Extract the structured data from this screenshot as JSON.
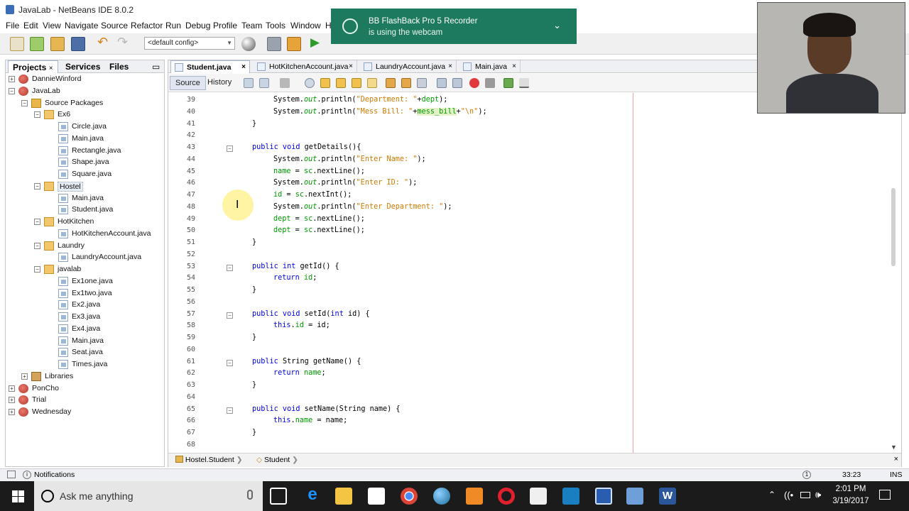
{
  "window": {
    "title": "JavaLab - NetBeans IDE 8.0.2"
  },
  "menu": [
    "File",
    "Edit",
    "View",
    "Navigate",
    "Source",
    "Refactor",
    "Run",
    "Debug",
    "Profile",
    "Team",
    "Tools",
    "Window",
    "H"
  ],
  "toolbar": {
    "config": "<default config>"
  },
  "left_panel": {
    "tabs": [
      "Projects",
      "Services",
      "Files"
    ],
    "close": "×",
    "minimize": "▭",
    "tree": [
      {
        "label": "DannieWinford",
        "type": "project",
        "depth": 0,
        "expander": "+"
      },
      {
        "label": "JavaLab",
        "type": "project",
        "depth": 0,
        "expander": "−"
      },
      {
        "label": "Source Packages",
        "type": "pkgfolder",
        "depth": 1,
        "expander": "−"
      },
      {
        "label": "Ex6",
        "type": "package",
        "depth": 2,
        "expander": "−"
      },
      {
        "label": "Circle.java",
        "type": "java",
        "depth": 3
      },
      {
        "label": "Main.java",
        "type": "java",
        "depth": 3
      },
      {
        "label": "Rectangle.java",
        "type": "java",
        "depth": 3
      },
      {
        "label": "Shape.java",
        "type": "java",
        "depth": 3
      },
      {
        "label": "Square.java",
        "type": "java",
        "depth": 3
      },
      {
        "label": "Hostel",
        "type": "package",
        "depth": 2,
        "expander": "−",
        "selected": true
      },
      {
        "label": "Main.java",
        "type": "java",
        "depth": 3
      },
      {
        "label": "Student.java",
        "type": "java",
        "depth": 3
      },
      {
        "label": "HotKitchen",
        "type": "package",
        "depth": 2,
        "expander": "−"
      },
      {
        "label": "HotKitchenAccount.java",
        "type": "java",
        "depth": 3
      },
      {
        "label": "Laundry",
        "type": "package",
        "depth": 2,
        "expander": "−"
      },
      {
        "label": "LaundryAccount.java",
        "type": "java",
        "depth": 3
      },
      {
        "label": "javalab",
        "type": "package",
        "depth": 2,
        "expander": "−"
      },
      {
        "label": "Ex1one.java",
        "type": "java",
        "depth": 3
      },
      {
        "label": "Ex1two.java",
        "type": "java",
        "depth": 3
      },
      {
        "label": "Ex2.java",
        "type": "java",
        "depth": 3
      },
      {
        "label": "Ex3.java",
        "type": "java",
        "depth": 3
      },
      {
        "label": "Ex4.java",
        "type": "java",
        "depth": 3
      },
      {
        "label": "Main.java",
        "type": "java",
        "depth": 3
      },
      {
        "label": "Seat.java",
        "type": "java",
        "depth": 3
      },
      {
        "label": "Times.java",
        "type": "java",
        "depth": 3
      },
      {
        "label": "Libraries",
        "type": "library",
        "depth": 1,
        "expander": "+"
      },
      {
        "label": "PonCho",
        "type": "project",
        "depth": 0,
        "expander": "+"
      },
      {
        "label": "Trial",
        "type": "project",
        "depth": 0,
        "expander": "+"
      },
      {
        "label": "Wednesday",
        "type": "project",
        "depth": 0,
        "expander": "+"
      }
    ]
  },
  "editor": {
    "tabs": [
      {
        "label": "Student.java",
        "active": true
      },
      {
        "label": "HotKitchenAccount.java"
      },
      {
        "label": "LaundryAccount.java"
      },
      {
        "label": "Main.java"
      }
    ],
    "tab_close": "×",
    "views": [
      "Source",
      "History"
    ],
    "lines": [
      {
        "n": "39",
        "indent": 2,
        "parts": [
          [
            "",
            "System."
          ],
          [
            "it",
            "out"
          ],
          [
            "",
            ".println("
          ],
          [
            "str",
            "\"Department: \""
          ],
          [
            "",
            "+"
          ],
          [
            "fld",
            "dept"
          ],
          [
            "",
            ");"
          ]
        ]
      },
      {
        "n": "40",
        "indent": 2,
        "parts": [
          [
            "",
            "System."
          ],
          [
            "it",
            "out"
          ],
          [
            "",
            ".println("
          ],
          [
            "str",
            "\"Mess Bill: \""
          ],
          [
            "",
            "+"
          ],
          [
            "fld hl",
            "mess_bill"
          ],
          [
            "",
            "+"
          ],
          [
            "str",
            "\"\\n\""
          ],
          [
            "",
            ");"
          ]
        ]
      },
      {
        "n": "41",
        "indent": 1,
        "parts": [
          [
            "",
            "}"
          ]
        ]
      },
      {
        "n": "42",
        "indent": 0,
        "parts": []
      },
      {
        "n": "43",
        "indent": 1,
        "fold": true,
        "parts": [
          [
            "kw",
            "public void "
          ],
          [
            "",
            "getDetails(){"
          ]
        ]
      },
      {
        "n": "44",
        "indent": 2,
        "parts": [
          [
            "",
            "System."
          ],
          [
            "it",
            "out"
          ],
          [
            "",
            ".println("
          ],
          [
            "str",
            "\"Enter Name: \""
          ],
          [
            "",
            ");"
          ]
        ]
      },
      {
        "n": "45",
        "indent": 2,
        "parts": [
          [
            "fld",
            "name"
          ],
          [
            "",
            " = "
          ],
          [
            "fld",
            "sc"
          ],
          [
            "",
            ".nextLine();"
          ]
        ]
      },
      {
        "n": "46",
        "indent": 2,
        "parts": [
          [
            "",
            "System."
          ],
          [
            "it",
            "out"
          ],
          [
            "",
            ".println("
          ],
          [
            "str",
            "\"Enter ID: \""
          ],
          [
            "",
            ");"
          ]
        ]
      },
      {
        "n": "47",
        "indent": 2,
        "parts": [
          [
            "fld",
            "id"
          ],
          [
            "",
            " = "
          ],
          [
            "fld",
            "sc"
          ],
          [
            "",
            ".nextInt();"
          ]
        ]
      },
      {
        "n": "48",
        "indent": 2,
        "parts": [
          [
            "",
            "System."
          ],
          [
            "it",
            "out"
          ],
          [
            "",
            ".println("
          ],
          [
            "str",
            "\"Enter Department: \""
          ],
          [
            "",
            ");"
          ]
        ]
      },
      {
        "n": "49",
        "indent": 2,
        "parts": [
          [
            "fld",
            "dept"
          ],
          [
            "",
            " = "
          ],
          [
            "fld",
            "sc"
          ],
          [
            "",
            ".nextLine();"
          ]
        ]
      },
      {
        "n": "50",
        "indent": 2,
        "parts": [
          [
            "fld",
            "dept"
          ],
          [
            "",
            " = "
          ],
          [
            "fld",
            "sc"
          ],
          [
            "",
            ".nextLine();"
          ]
        ]
      },
      {
        "n": "51",
        "indent": 1,
        "parts": [
          [
            "",
            "}"
          ]
        ]
      },
      {
        "n": "52",
        "indent": 0,
        "parts": []
      },
      {
        "n": "53",
        "indent": 1,
        "fold": true,
        "parts": [
          [
            "kw",
            "public int "
          ],
          [
            "",
            "getId() {"
          ]
        ]
      },
      {
        "n": "54",
        "indent": 2,
        "parts": [
          [
            "kw",
            "return "
          ],
          [
            "fld",
            "id"
          ],
          [
            "",
            ";"
          ]
        ]
      },
      {
        "n": "55",
        "indent": 1,
        "parts": [
          [
            "",
            "}"
          ]
        ]
      },
      {
        "n": "56",
        "indent": 0,
        "parts": []
      },
      {
        "n": "57",
        "indent": 1,
        "fold": true,
        "parts": [
          [
            "kw",
            "public void "
          ],
          [
            "",
            "setId("
          ],
          [
            "kw",
            "int "
          ],
          [
            "",
            "id) {"
          ]
        ]
      },
      {
        "n": "58",
        "indent": 2,
        "parts": [
          [
            "kw",
            "this"
          ],
          [
            "",
            "."
          ],
          [
            "fld",
            "id"
          ],
          [
            "",
            " = id;"
          ]
        ]
      },
      {
        "n": "59",
        "indent": 1,
        "parts": [
          [
            "",
            "}"
          ]
        ]
      },
      {
        "n": "60",
        "indent": 0,
        "parts": []
      },
      {
        "n": "61",
        "indent": 1,
        "fold": true,
        "parts": [
          [
            "kw",
            "public "
          ],
          [
            "",
            "String getName() {"
          ]
        ]
      },
      {
        "n": "62",
        "indent": 2,
        "parts": [
          [
            "kw",
            "return "
          ],
          [
            "fld",
            "name"
          ],
          [
            "",
            ";"
          ]
        ]
      },
      {
        "n": "63",
        "indent": 1,
        "parts": [
          [
            "",
            "}"
          ]
        ]
      },
      {
        "n": "64",
        "indent": 0,
        "parts": []
      },
      {
        "n": "65",
        "indent": 1,
        "fold": true,
        "parts": [
          [
            "kw",
            "public void "
          ],
          [
            "",
            "setName(String name) {"
          ]
        ]
      },
      {
        "n": "66",
        "indent": 2,
        "parts": [
          [
            "kw",
            "this"
          ],
          [
            "",
            "."
          ],
          [
            "fld",
            "name"
          ],
          [
            "",
            " = name;"
          ]
        ]
      },
      {
        "n": "67",
        "indent": 1,
        "parts": [
          [
            "",
            "}"
          ]
        ]
      },
      {
        "n": "68",
        "indent": 0,
        "parts": []
      }
    ],
    "breadcrumb": [
      "Hostel.Student",
      "Student"
    ]
  },
  "status": {
    "notifications": "Notifications",
    "position": "33:23",
    "mode": "INS"
  },
  "notification": {
    "title": "BB FlashBack Pro 5 Recorder",
    "body": "is using the webcam",
    "chevron": "⌄"
  },
  "taskbar": {
    "search": "Ask me anything",
    "time": "2:01 PM",
    "date": "3/19/2017"
  },
  "colors": {
    "keyword": "#0000e6",
    "string": "#ce7b00",
    "field": "#009900",
    "notification": "#1e7a5e"
  }
}
